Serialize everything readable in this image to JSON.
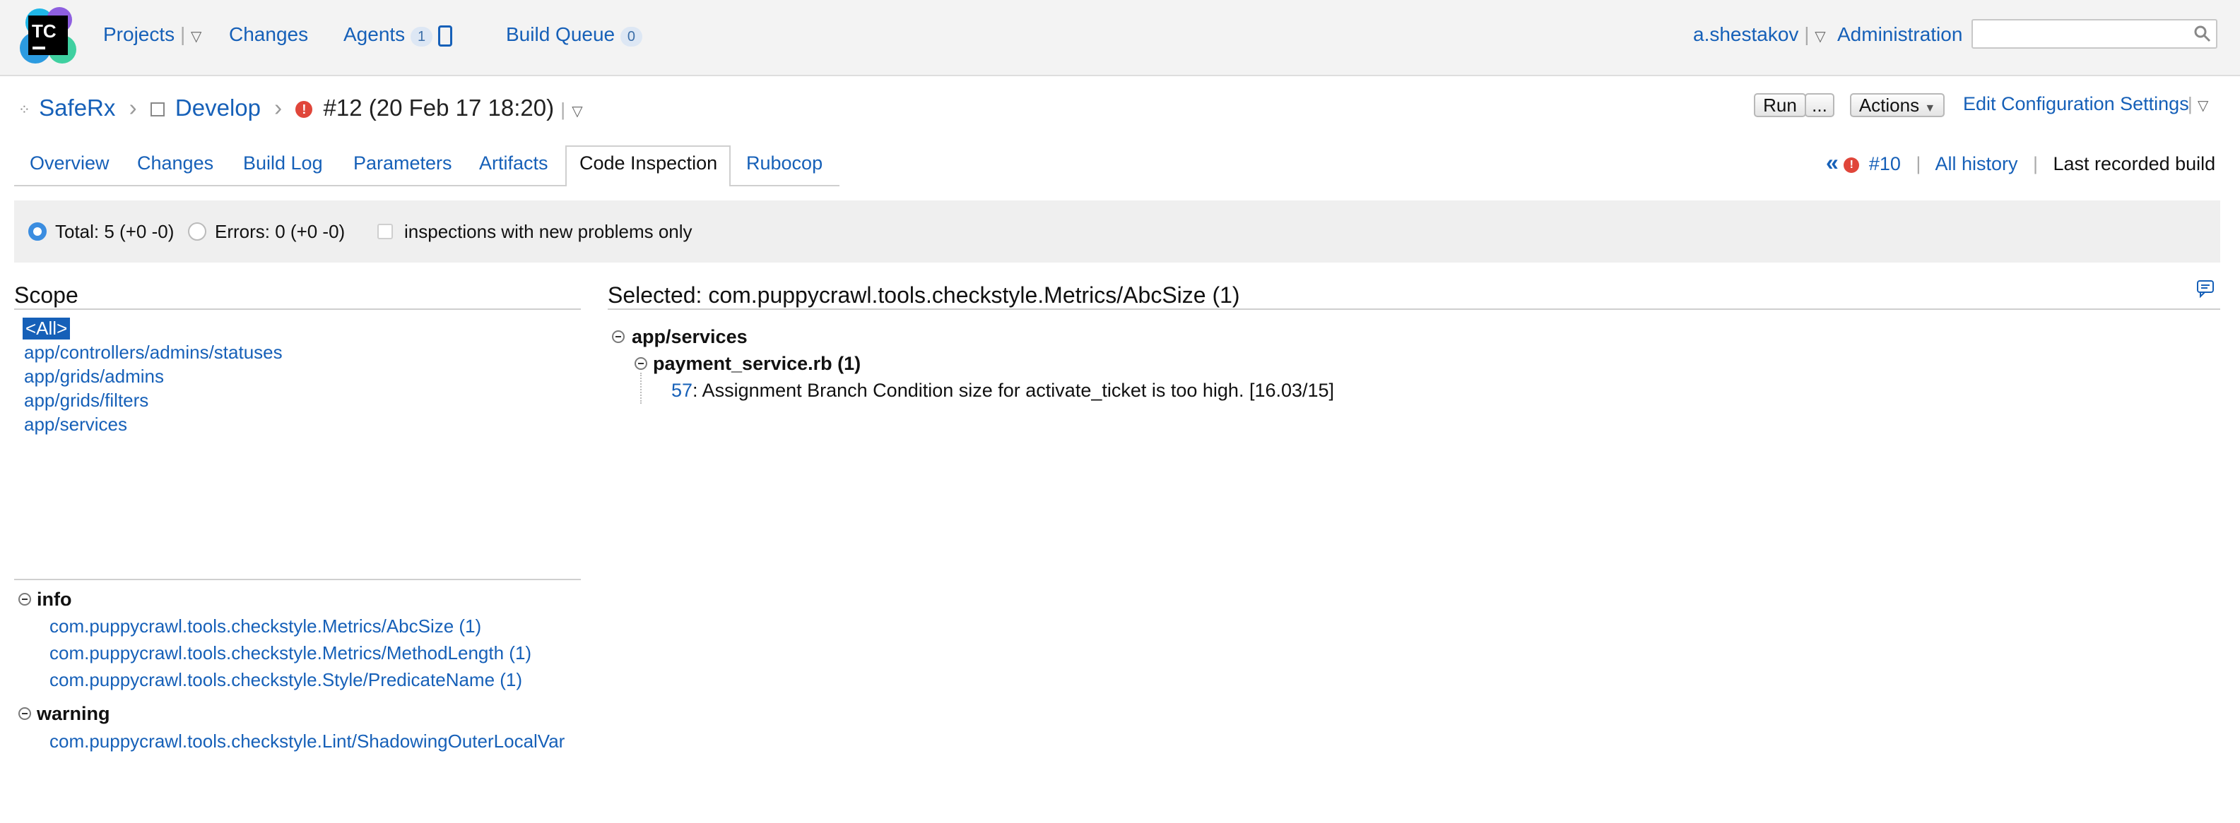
{
  "header": {
    "logo_text": "TC",
    "nav": {
      "projects": "Projects",
      "changes": "Changes",
      "agents": "Agents",
      "agents_count": "1",
      "build_queue": "Build Queue",
      "build_queue_count": "0"
    },
    "user": "a.shestakov",
    "administration": "Administration",
    "search": {
      "value": "",
      "placeholder": ""
    }
  },
  "breadcrumb": {
    "project": "SafeRx",
    "config": "Develop",
    "build": "#12 (20 Feb 17 18:20)"
  },
  "toolbar": {
    "run": "Run",
    "more": "...",
    "actions": "Actions",
    "edit_settings": "Edit Configuration Settings"
  },
  "tabs": [
    "Overview",
    "Changes",
    "Build Log",
    "Parameters",
    "Artifacts",
    "Code Inspection",
    "Rubocop"
  ],
  "active_tab": "Code Inspection",
  "history": {
    "prev_glyph": "«",
    "prev_build": "#10",
    "all_history": "All history",
    "last_recorded": "Last recorded build"
  },
  "filters": {
    "total": "Total: 5 (+0 -0)",
    "errors": "Errors: 0 (+0 -0)",
    "new_only": "inspections with new problems only"
  },
  "scope": {
    "title": "Scope",
    "items": [
      "<All>",
      "app/controllers/admins/statuses",
      "app/grids/admins",
      "app/grids/filters",
      "app/services"
    ]
  },
  "inspections": {
    "groups": [
      {
        "label": "info",
        "items": [
          "com.puppycrawl.tools.checkstyle.Metrics/AbcSize (1)",
          "com.puppycrawl.tools.checkstyle.Metrics/MethodLength (1)",
          "com.puppycrawl.tools.checkstyle.Style/PredicateName (1)"
        ]
      },
      {
        "label": "warning",
        "items": [
          "com.puppycrawl.tools.checkstyle.Lint/ShadowingOuterLocalVar"
        ]
      }
    ]
  },
  "selected": {
    "title": "Selected: com.puppycrawl.tools.checkstyle.Metrics/AbcSize (1)",
    "folder": "app/services",
    "file": "payment_service.rb (1)",
    "line": "57",
    "message": ": Assignment Branch Condition size for activate_ticket is too high. [16.03/15]"
  },
  "colors": {
    "link": "#1660b8",
    "error": "#e0463a",
    "selected_scope_bg": "#1660b8",
    "radio_checked": "#3b8de0"
  }
}
